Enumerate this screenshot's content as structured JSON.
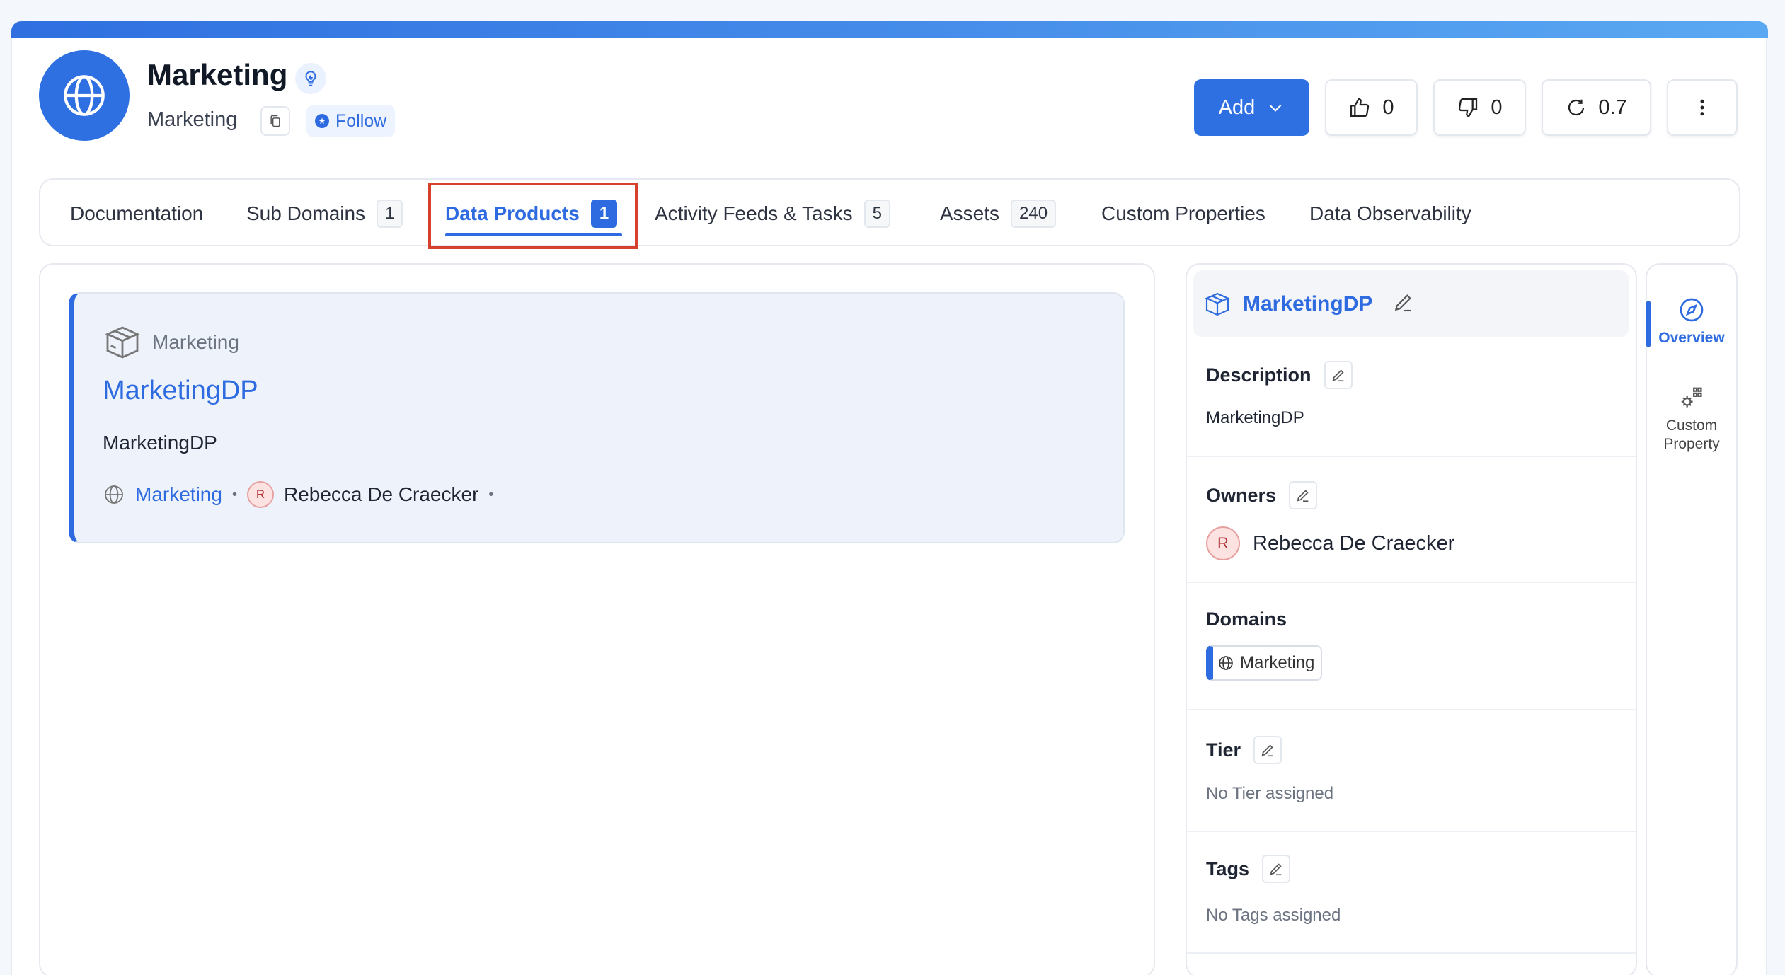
{
  "header": {
    "title": "Marketing",
    "subtitle": "Marketing",
    "follow_label": "Follow"
  },
  "actions": {
    "add_label": "Add",
    "upvotes": "0",
    "downvotes": "0",
    "version": "0.7"
  },
  "tabs": [
    {
      "label": "Documentation",
      "count": ""
    },
    {
      "label": "Sub Domains",
      "count": "1"
    },
    {
      "label": "Data Products",
      "count": "1"
    },
    {
      "label": "Activity Feeds & Tasks",
      "count": "5"
    },
    {
      "label": "Assets",
      "count": "240"
    },
    {
      "label": "Custom Properties",
      "count": ""
    },
    {
      "label": "Data Observability",
      "count": ""
    }
  ],
  "data_product_card": {
    "domain_label": "Marketing",
    "name": "MarketingDP",
    "description": "MarketingDP",
    "domain_link": "Marketing",
    "owner_initial": "R",
    "owner_name": "Rebecca De Craecker"
  },
  "details": {
    "title": "MarketingDP",
    "description_label": "Description",
    "description_value": "MarketingDP",
    "owners_label": "Owners",
    "owner_initial": "R",
    "owner_name": "Rebecca De Craecker",
    "domains_label": "Domains",
    "domain_chip": "Marketing",
    "tier_label": "Tier",
    "tier_value": "No Tier assigned",
    "tags_label": "Tags",
    "tags_value": "No Tags assigned"
  },
  "side_tabs": {
    "overview": "Overview",
    "custom_property_line1": "Custom",
    "custom_property_line2": "Property"
  },
  "colors": {
    "accent": "#2e6be0",
    "highlight_box": "#d8402e"
  }
}
